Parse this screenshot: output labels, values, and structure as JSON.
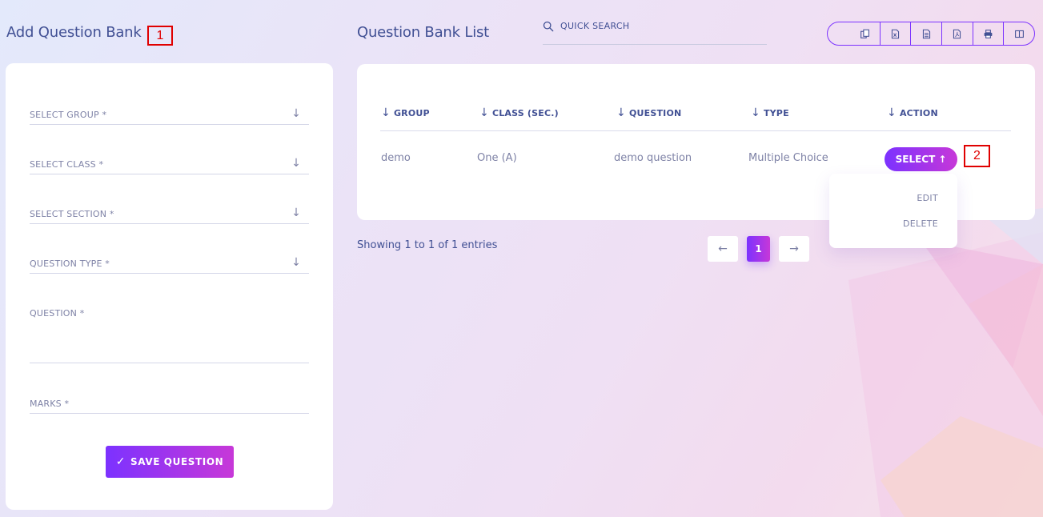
{
  "left": {
    "title": "Add Question Bank",
    "annotation": "1",
    "fields": {
      "group": "SELECT GROUP *",
      "class": "SELECT CLASS *",
      "section": "SELECT SECTION *",
      "question_type": "QUESTION TYPE *",
      "question": "QUESTION *",
      "marks": "MARKS *"
    },
    "save_button": "SAVE QUESTION",
    "save_icon": "✓"
  },
  "right": {
    "title": "Question Bank List",
    "search_placeholder": "QUICK SEARCH",
    "export_buttons": [
      "copy-icon",
      "excel-icon",
      "csv-icon",
      "pdf-icon",
      "print-icon",
      "columns-icon"
    ],
    "table": {
      "headers": [
        "GROUP",
        "CLASS (SEC.)",
        "QUESTION",
        "TYPE",
        "ACTION"
      ],
      "rows": [
        {
          "group": "demo",
          "class": "One (A)",
          "question": "demo question",
          "type": "Multiple Choice"
        }
      ],
      "select_button": "SELECT",
      "annotation": "2"
    },
    "dropdown": {
      "edit": "EDIT",
      "delete": "DELETE"
    },
    "entries_info": "Showing 1 to 1 of 1 entries",
    "pagination": {
      "prev": "←",
      "current": "1",
      "next": "→"
    }
  },
  "colors": {
    "accent_start": "#7c32ff",
    "accent_end": "#c738d8",
    "text": "#415094",
    "muted": "#7e82a6"
  }
}
